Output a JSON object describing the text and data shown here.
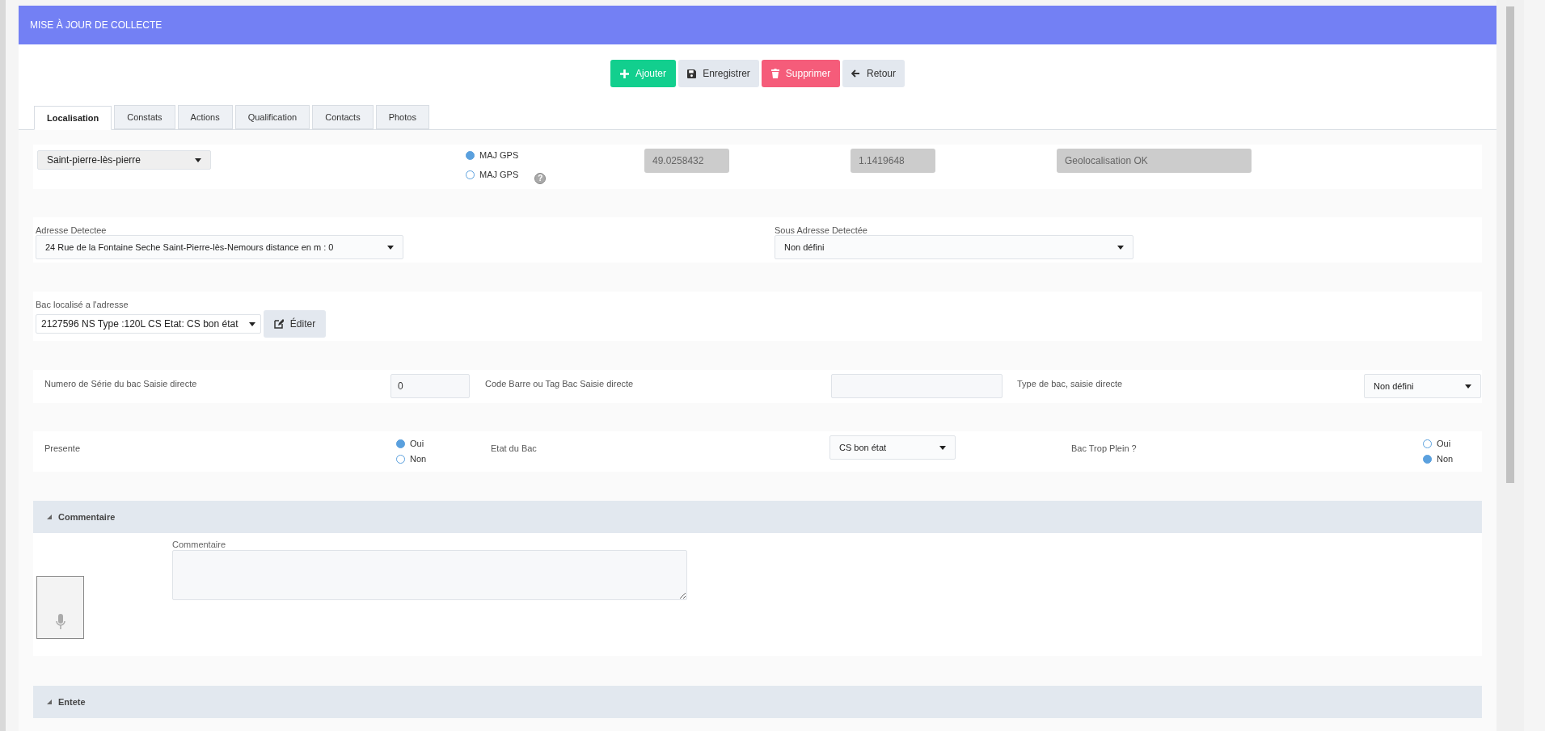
{
  "header": {
    "title": "MISE À JOUR DE COLLECTE"
  },
  "buttons": [
    {
      "label": "Ajouter",
      "kind": "add"
    },
    {
      "label": "Enregistrer",
      "kind": "save"
    },
    {
      "label": "Supprimer",
      "kind": "delete"
    },
    {
      "label": "Retour",
      "kind": "back"
    }
  ],
  "tabs": [
    {
      "label": "Localisation",
      "selected": true
    },
    {
      "label": "Constats",
      "selected": false
    },
    {
      "label": "Actions",
      "selected": false
    },
    {
      "label": "Qualification",
      "selected": false
    },
    {
      "label": "Contacts",
      "selected": false
    },
    {
      "label": "Photos",
      "selected": false
    }
  ],
  "location": {
    "commune": "Saint-pierre-lès-pierre",
    "gps_options": [
      {
        "label": "MAJ GPS",
        "selected": true
      },
      {
        "label": "MAJ GPS",
        "selected": false,
        "help": "?"
      }
    ],
    "latitude": "49.0258432",
    "longitude": "1.1419648",
    "status": "Geolocalisation OK"
  },
  "address": {
    "label": "Adresse Detectee",
    "value": "24 Rue de la Fontaine Seche Saint-Pierre-lès-Nemours distance en m : 0",
    "sub_label": "Sous Adresse Detectée",
    "sub_value": "Non défini"
  },
  "bin": {
    "label": "Bac localisé a l'adresse",
    "value": "2127596 NS Type :120L CS Etat: CS bon état",
    "edit_button": "Éditer"
  },
  "direct": {
    "serial_label": "Numero de Série du bac Saisie directe",
    "serial_value": "0",
    "barcode_label": "Code Barre ou Tag Bac Saisie directe",
    "type_label": "Type de bac, saisie directe",
    "type_value": "Non défini"
  },
  "presence": {
    "label": "Presente",
    "options": [
      {
        "label": "Oui",
        "selected": true
      },
      {
        "label": "Non",
        "selected": false
      }
    ],
    "state_label": "Etat du Bac",
    "state_value": "CS bon état",
    "full_label": "Bac Trop Plein ?",
    "full_options": [
      {
        "label": "Oui",
        "selected": false
      },
      {
        "label": "Non",
        "selected": true
      }
    ]
  },
  "sections": [
    {
      "title": "Commentaire",
      "expanded": true,
      "field_label": "Commentaire"
    },
    {
      "title": "Entete",
      "expanded": true
    }
  ]
}
